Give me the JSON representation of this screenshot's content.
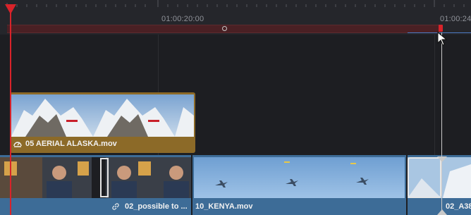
{
  "ruler": {
    "timecodes": [
      "01:00:20:00",
      "01:00:24"
    ]
  },
  "tracks": {
    "v2": {
      "clip_name": "05 AERIAL  ALASKA.mov"
    },
    "v1": {
      "clip_a_name": "02_possible to ...",
      "clip_b_name": "10_KENYA.mov",
      "clip_c_name": "02_A38"
    }
  },
  "colors": {
    "playhead": "#d8232a",
    "gold_clip": "#8c6a28",
    "blue_clip": "#3d6c97"
  },
  "icons": {
    "speed": "speedometer-icon",
    "link": "link-icon"
  }
}
